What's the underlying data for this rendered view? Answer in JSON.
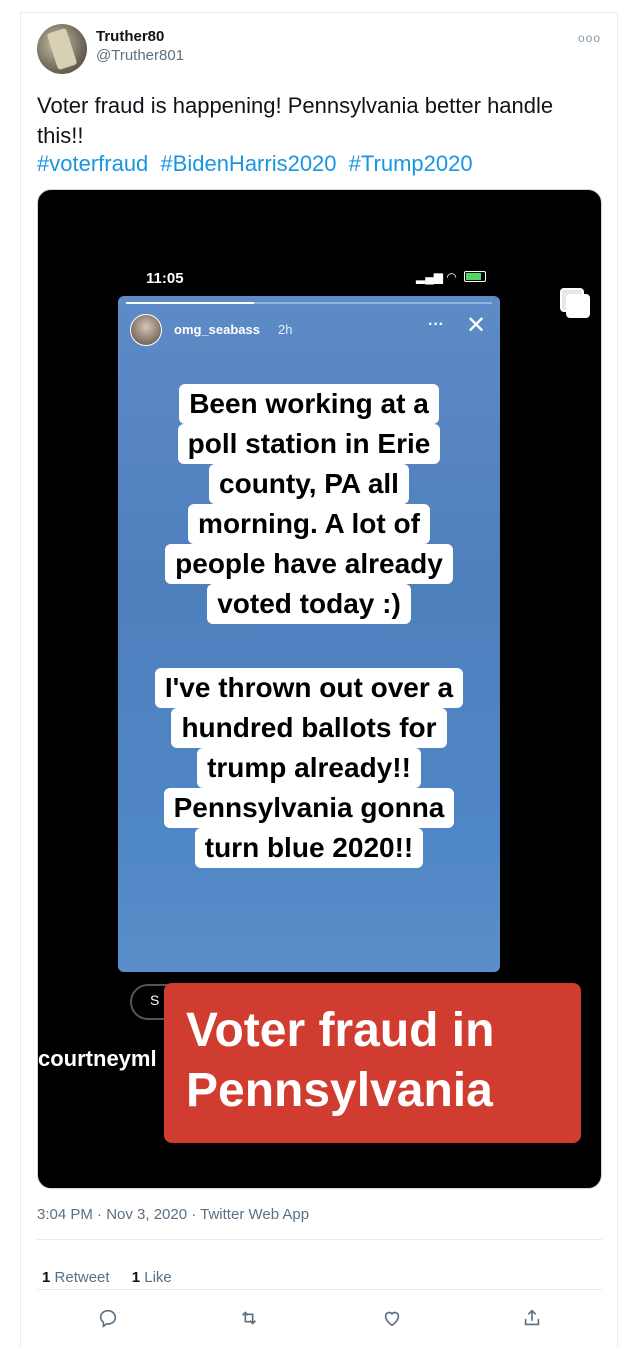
{
  "tweet": {
    "display_name": "Truther80",
    "handle": "@Truther801",
    "more_icon": "ooo",
    "text": "Voter fraud is happening! Pennsylvania better handle this!!",
    "hashtags": [
      "#voterfraud",
      "#BidenHarris2020",
      "#Trump2020"
    ],
    "meta": "3:04 PM · Nov 3, 2020 · Twitter Web App",
    "retweet_count": "1",
    "retweet_label": "Retweet",
    "like_count": "1",
    "like_label": "Like"
  },
  "media": {
    "phone_time": "11:05",
    "story": {
      "username": "omg_seabass",
      "age": "2h",
      "more": "···",
      "close": "✕",
      "progress": 0.35,
      "text_block_1": [
        "Been working at a",
        "poll station in Erie",
        "county, PA all",
        "morning. A lot of",
        "people have already",
        "voted today :)"
      ],
      "text_block_2": [
        "I've thrown out over a",
        "hundred ballots for",
        "trump already!!",
        "Pennsylvania gonna",
        "turn blue 2020!!"
      ]
    },
    "send_partial": "S",
    "mention_partial": "courtneyml",
    "banner_text": "Voter fraud in\nPennsylvania"
  },
  "colors": {
    "accent": "#1b95e0",
    "banner": "#d13c31",
    "muted": "#5b7083"
  },
  "icons": {
    "reply": "reply-icon",
    "retweet": "retweet-icon",
    "like": "heart-icon",
    "share": "share-icon"
  }
}
